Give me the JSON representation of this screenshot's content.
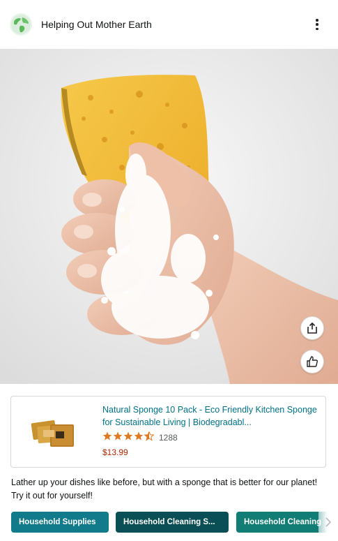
{
  "header": {
    "title": "Helping Out Mother Earth",
    "avatar_icon": "globe-icon",
    "more_icon": "more-vertical-icon"
  },
  "hero": {
    "share_icon": "share-icon",
    "like_icon": "thumbs-up-icon"
  },
  "product": {
    "title": "Natural Sponge 10 Pack - Eco Friendly Kitchen Sponge for Sustainable Living | Biodegradabl...",
    "rating": 4.5,
    "stars": "★★★★★",
    "rating_count": "1288",
    "price": "$13.99"
  },
  "caption": "Lather up your dishes like before, but with a sponge that is better for our planet! Try it out for yourself!",
  "tags": [
    {
      "label": "Household Supplies"
    },
    {
      "label": "Household Cleaning S..."
    },
    {
      "label": "Household Cleaning"
    }
  ],
  "colors": {
    "link": "#007185",
    "price": "#b12704",
    "star": "#de7921",
    "tag_1": "#117a8b",
    "tag_2": "#0b4f56",
    "tag_3": "#127d75"
  }
}
